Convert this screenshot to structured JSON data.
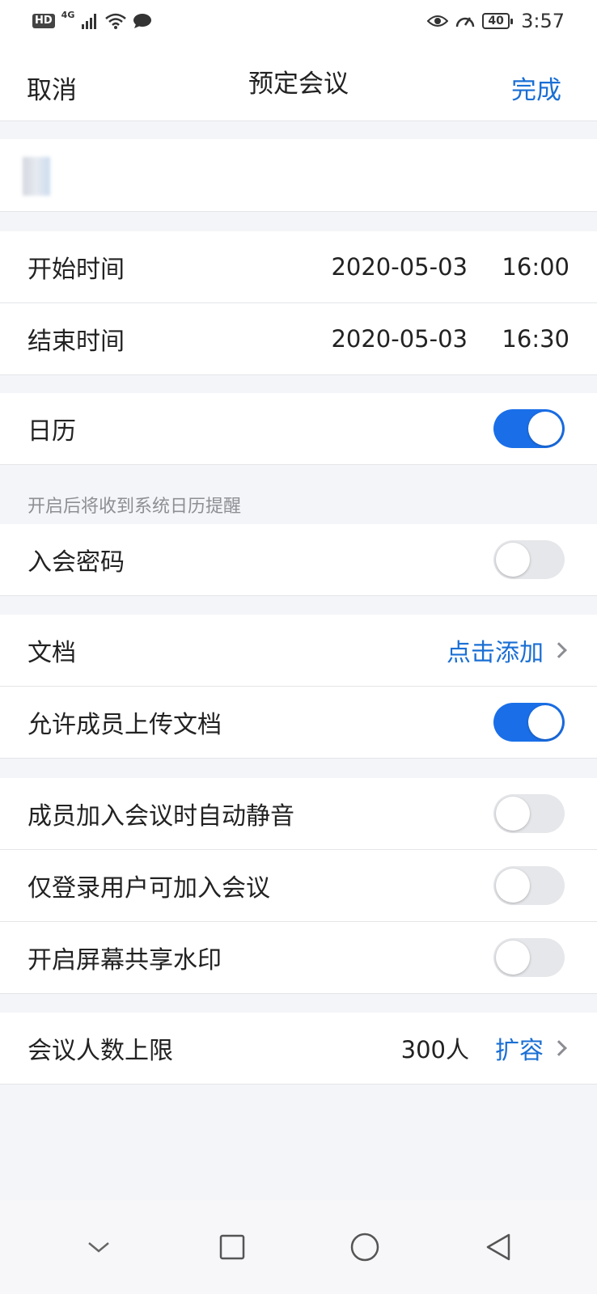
{
  "status_bar": {
    "left_badge": "HD",
    "network": "4G",
    "battery": "40",
    "time": "3:57"
  },
  "header": {
    "cancel": "取消",
    "title": "预定会议",
    "done": "完成"
  },
  "topic": {
    "value": ""
  },
  "time_rows": [
    {
      "label": "开始时间",
      "date": "2020-05-03",
      "time": "16:00"
    },
    {
      "label": "结束时间",
      "date": "2020-05-03",
      "time": "16:30"
    }
  ],
  "calendar": {
    "label": "日历",
    "enabled": true,
    "hint": "开启后将收到系统日历提醒"
  },
  "password": {
    "label": "入会密码",
    "enabled": false
  },
  "document": {
    "label": "文档",
    "action": "点击添加"
  },
  "allow_upload": {
    "label": "允许成员上传文档",
    "enabled": true
  },
  "settings": [
    {
      "label": "成员加入会议时自动静音",
      "enabled": false
    },
    {
      "label": "仅登录用户可加入会议",
      "enabled": false
    },
    {
      "label": "开启屏幕共享水印",
      "enabled": false
    }
  ],
  "capacity": {
    "label": "会议人数上限",
    "value": "300人",
    "action": "扩容"
  },
  "nav": [
    "chevron-down-icon",
    "square-icon",
    "circle-icon",
    "triangle-back-icon"
  ],
  "colors": {
    "accent": "#1a6fd4",
    "toggle_on": "#1a6fe8",
    "toggle_off": "#e6e7ea",
    "background": "#f4f5f8"
  }
}
